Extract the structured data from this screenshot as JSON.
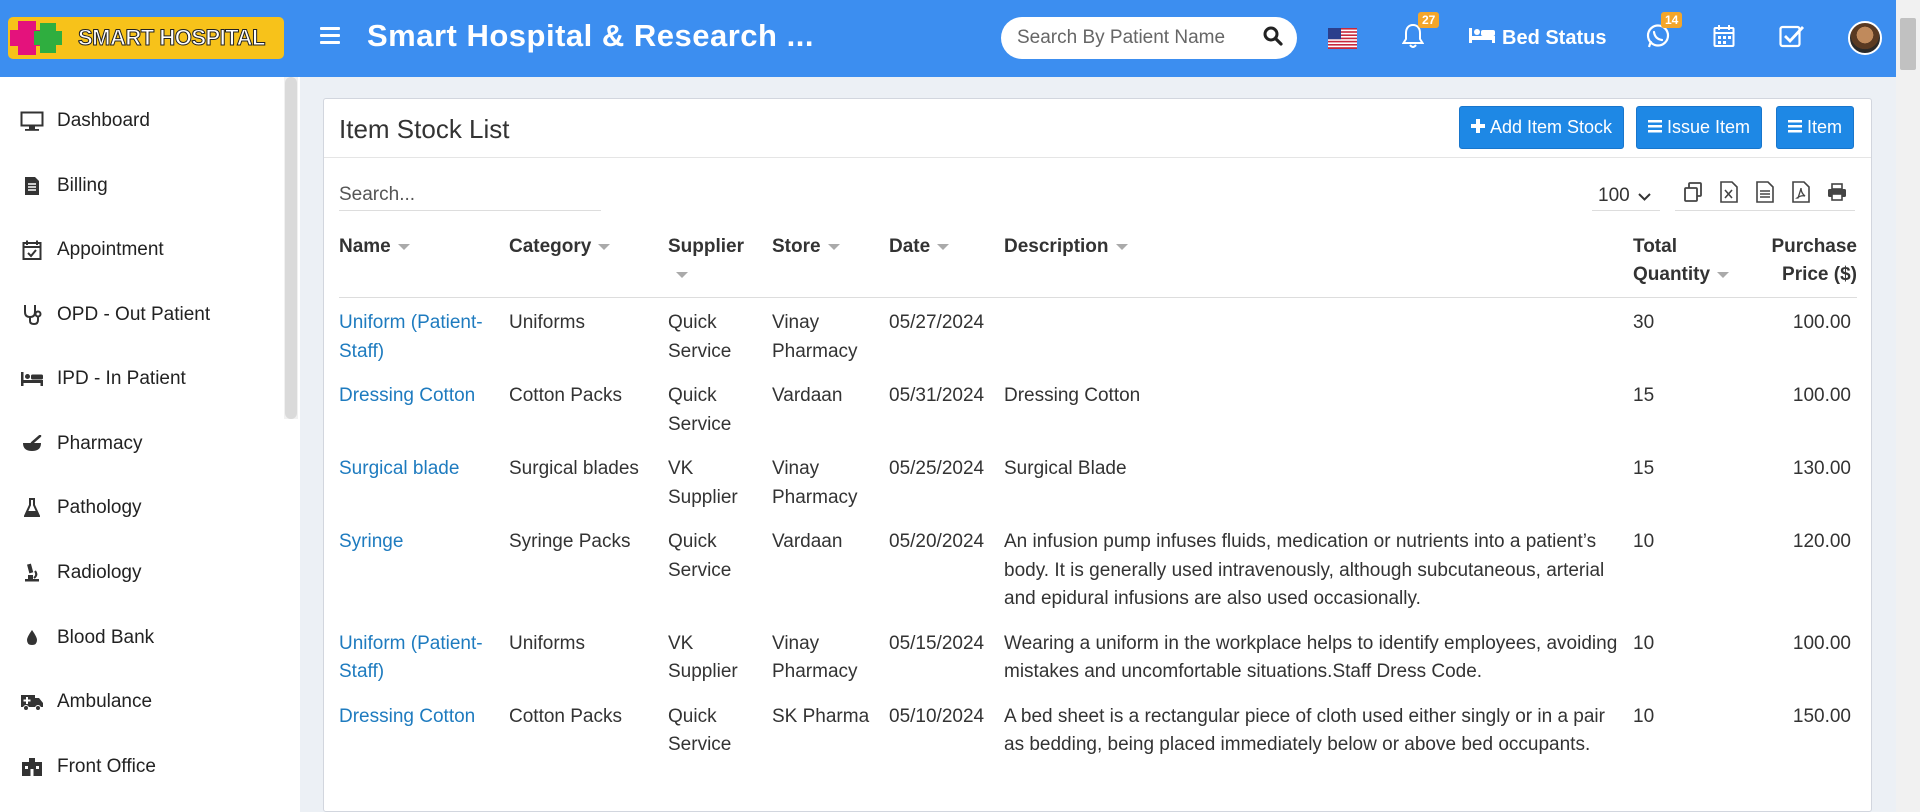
{
  "header": {
    "logo_text": "SMART HOSPITAL",
    "app_title": "Smart Hospital & Research ...",
    "search_placeholder": "Search By Patient Name",
    "notifications_count": "27",
    "bed_status_label": "Bed Status",
    "whatsapp_count": "14",
    "accent_color": "#3c8ef0"
  },
  "sidebar": {
    "items": [
      {
        "label": "Dashboard",
        "icon": "monitor-icon"
      },
      {
        "label": "Billing",
        "icon": "invoice-icon"
      },
      {
        "label": "Appointment",
        "icon": "calendar-check-icon"
      },
      {
        "label": "OPD - Out Patient",
        "icon": "stethoscope-icon"
      },
      {
        "label": "IPD - In Patient",
        "icon": "bed-icon"
      },
      {
        "label": "Pharmacy",
        "icon": "mortar-pestle-icon"
      },
      {
        "label": "Pathology",
        "icon": "flask-icon"
      },
      {
        "label": "Radiology",
        "icon": "microscope-icon"
      },
      {
        "label": "Blood Bank",
        "icon": "blood-drop-icon"
      },
      {
        "label": "Ambulance",
        "icon": "ambulance-icon"
      },
      {
        "label": "Front Office",
        "icon": "building-icon"
      }
    ]
  },
  "panel": {
    "title": "Item Stock List",
    "buttons": {
      "add_item_stock": "Add Item Stock",
      "issue_item": "Issue Item",
      "item": "Item"
    },
    "search_placeholder": "Search...",
    "page_length": "100",
    "columns": [
      "Name",
      "Category",
      "Supplier",
      "Store",
      "Date",
      "Description",
      "Total Quantity",
      "Purchase Price ($)"
    ],
    "rows": [
      {
        "name": "Uniform (Patient-Staff)",
        "category": "Uniforms",
        "supplier": "Quick Service",
        "store": "Vinay Pharmacy",
        "date": "05/27/2024",
        "description": "",
        "quantity": "30",
        "price": "100.00"
      },
      {
        "name": "Dressing Cotton",
        "category": "Cotton Packs",
        "supplier": "Quick Service",
        "store": "Vardaan",
        "date": "05/31/2024",
        "description": "Dressing Cotton",
        "quantity": "15",
        "price": "100.00"
      },
      {
        "name": "Surgical blade",
        "category": "Surgical blades",
        "supplier": "VK Supplier",
        "store": "Vinay Pharmacy",
        "date": "05/25/2024",
        "description": "Surgical Blade",
        "quantity": "15",
        "price": "130.00"
      },
      {
        "name": "Syringe",
        "category": "Syringe Packs",
        "supplier": "Quick Service",
        "store": "Vardaan",
        "date": "05/20/2024",
        "description": "An infusion pump infuses fluids, medication or nutrients into a patient’s body. It is generally used intravenously, although subcutaneous, arterial and epidural infusions are also used occasionally.",
        "quantity": "10",
        "price": "120.00"
      },
      {
        "name": "Uniform (Patient-Staff)",
        "category": "Uniforms",
        "supplier": "VK Supplier",
        "store": "Vinay Pharmacy",
        "date": "05/15/2024",
        "description": "Wearing a uniform in the workplace helps to identify employees, avoiding mistakes and uncomfortable situations.Staff Dress Code.",
        "quantity": "10",
        "price": "100.00"
      },
      {
        "name": "Dressing Cotton",
        "category": "Cotton Packs",
        "supplier": "Quick Service",
        "store": "SK Pharma",
        "date": "05/10/2024",
        "description": "A bed sheet is a rectangular piece of cloth used either singly or in a pair as bedding, being placed immediately below or above bed occupants.",
        "quantity": "10",
        "price": "150.00"
      }
    ]
  }
}
